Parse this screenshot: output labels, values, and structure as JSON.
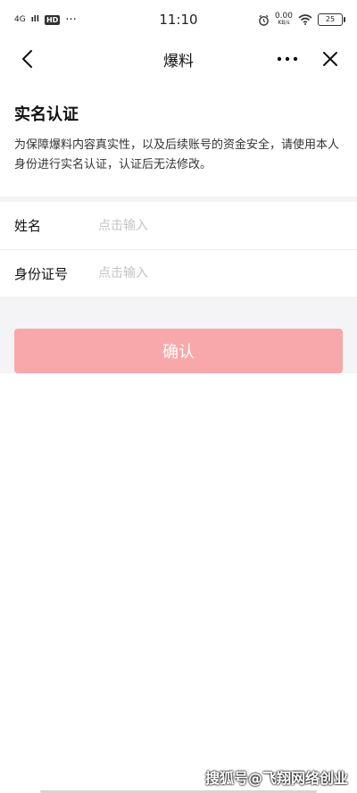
{
  "statusbar": {
    "network": "4G",
    "signal": "ıll",
    "hd": "HD",
    "dots": "···",
    "time": "11:10",
    "speed_value": "0.00",
    "speed_unit": "KB/s",
    "battery": "25"
  },
  "navbar": {
    "title": "爆料"
  },
  "intro": {
    "heading": "实名认证",
    "description": "为保障爆料内容真实性，以及后续账号的资金安全，请使用本人身份进行实名认证，认证后无法修改。"
  },
  "form": {
    "name_label": "姓名",
    "name_placeholder": "点击输入",
    "id_label": "身份证号",
    "id_placeholder": "点击输入"
  },
  "confirm_label": "确认",
  "watermark": "搜狐号@飞翔网络创业",
  "colors": {
    "confirm_bg": "#f8a8ab",
    "page_bg": "#f4f4f6"
  }
}
